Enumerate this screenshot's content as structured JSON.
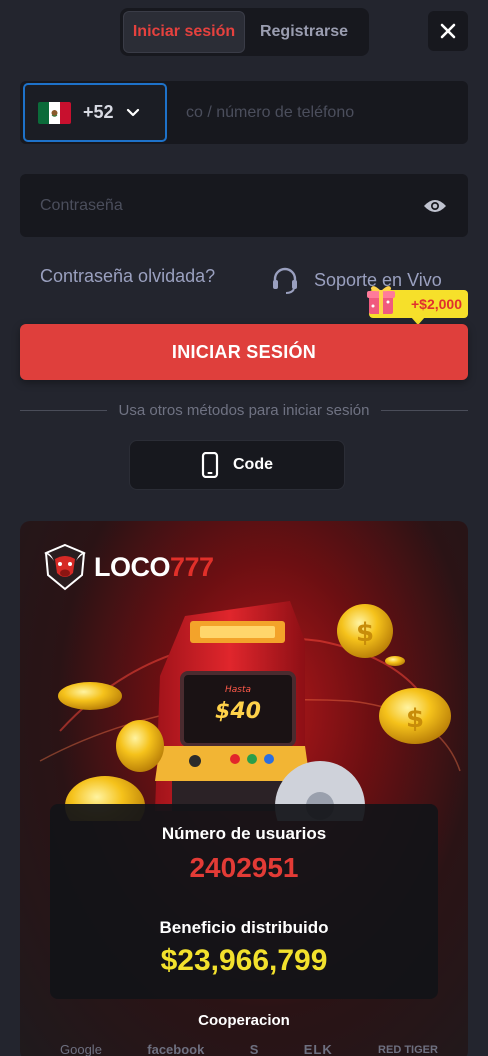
{
  "tabs": {
    "login_label": "Iniciar sesión",
    "register_label": "Registrarse"
  },
  "phone": {
    "country_code": "+52",
    "placeholder": "Número de teléfono / número de teléfono",
    "visible_placeholder": "co / número de teléfono"
  },
  "password": {
    "placeholder": "Contraseña"
  },
  "links": {
    "forgot": "Contraseña olvidada?",
    "support": "Soporte en Vivo"
  },
  "bonus": {
    "amount": "+$2,000"
  },
  "login_button": {
    "label": "INICIAR SESIÓN"
  },
  "divider": {
    "text": "Usa otros métodos para iniciar sesión"
  },
  "alt_login": {
    "code_label": "Code"
  },
  "promo": {
    "logo_white": "LOCO",
    "logo_red": "777",
    "machine_screen_small": "Hasta",
    "machine_screen_amount": "$40",
    "users_label": "Número de usuarios",
    "users_value": "2402951",
    "benefit_label": "Beneficio distribuido",
    "benefit_value": "$23,966,799",
    "cooperation_label": "Cooperacion",
    "partners": [
      "Google",
      "facebook",
      "S",
      "ELK",
      "RED TIGER"
    ]
  },
  "colors": {
    "accent_red": "#df3f3c",
    "focus_blue": "#1e72c9",
    "gold": "#f2e12d",
    "background": "#23252e"
  },
  "icons": {
    "close": "close-icon",
    "dropdown": "chevron-down-icon",
    "eye": "eye-icon",
    "support": "headset-icon",
    "gift": "gift-icon",
    "phone": "smartphone-icon"
  }
}
